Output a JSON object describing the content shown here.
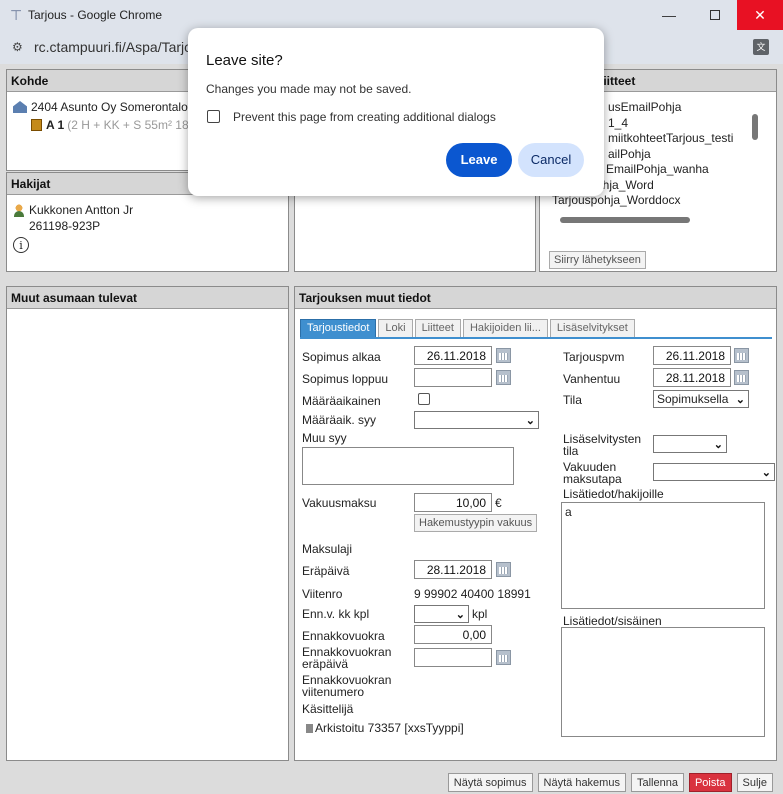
{
  "window": {
    "title": "Tarjous - Google Chrome",
    "minimize": "—",
    "close": "✕"
  },
  "address": {
    "url": "rc.ctampuuri.fi/Aspa/Tarjou"
  },
  "dialog": {
    "title": "Leave site?",
    "message": "Changes you made may not be saved.",
    "checkbox_label": "Prevent this page from creating additional dialogs",
    "leave": "Leave",
    "cancel": "Cancel"
  },
  "kohde": {
    "header": "Kohde",
    "property": "2404 Asunto Oy Somerontalot",
    "apartment": "A 1",
    "apartment_detail": "(2 H + KK + S 55m² 18"
  },
  "hakijat": {
    "header": "Hakijat",
    "name": "Kukkonen Antton Jr",
    "id": "261198-923P",
    "info_glyph": "i"
  },
  "muut": {
    "header": "Muut asumaan tulevat"
  },
  "liitteet": {
    "header": "liitteet",
    "items": [
      "usEmailPohja",
      "1_4",
      "miitkohteetTarjous_testi",
      "ailPohja",
      "EmailPohja_wanha",
      "ohja_Word",
      "Tarjouspohja_Worddocx"
    ],
    "send_button": "Siirry lähetykseen"
  },
  "tarjous": {
    "header": "Tarjouksen muut tiedot",
    "tabs": [
      "Tarjoustiedot",
      "Loki",
      "Liitteet",
      "Hakijoiden lii...",
      "Lisäselvitykset"
    ],
    "labels": {
      "sopimus_alkaa": "Sopimus alkaa",
      "sopimus_loppuu": "Sopimus loppuu",
      "maaraaikainen": "Määräaikainen",
      "maaraaik_syy": "Määräaik. syy",
      "muu_syy": "Muu syy",
      "vakuusmaksu": "Vakuusmaksu",
      "maksulaji": "Maksulaji",
      "erapaiva": "Eräpäivä",
      "viitenro": "Viitenro",
      "ennv_kk": "Enn.v. kk kpl",
      "ennakkovuokra": "Ennakkovuokra",
      "ennakko_erapaiva_1": "Ennakkovuokran",
      "ennakko_erapaiva_2": "eräpäivä",
      "ennakko_viite_1": "Ennakkovuokran",
      "ennakko_viite_2": "viitenumero",
      "kasittelija": "Käsittelijä",
      "tarjouspvm": "Tarjouspvm",
      "vanhentuu": "Vanhentuu",
      "tila": "Tila",
      "lisaselv_tila_1": "Lisäselvitysten",
      "lisaselv_tila_2": "tila",
      "vakuuden_1": "Vakuuden",
      "vakuuden_2": "maksutapa",
      "lisatiedot_hakijoille": "Lisätiedot/hakijoille",
      "lisatiedot_sisainen": "Lisätiedot/sisäinen"
    },
    "values": {
      "sopimus_alkaa": "26.11.2018",
      "vakuusmaksu": "10,00",
      "euro": "€",
      "vakuus_button": "Hakemustyypin vakuus",
      "erapaiva": "28.11.2018",
      "viitenro": "9 99902 40400 18991",
      "kpl": "kpl",
      "ennakkovuokra": "0,00",
      "kasittelija": "Arkistoitu 73357 [xxsTyyppi]",
      "tarjouspvm": "26.11.2018",
      "vanhentuu": "28.11.2018",
      "tila": "Sopimuksella",
      "lisatiedot_hakijoille": "a"
    }
  },
  "buttons": {
    "nayta_sopimus": "Näytä sopimus",
    "nayta_hakemus": "Näytä hakemus",
    "tallenna": "Tallenna",
    "poista": "Poista",
    "sulje": "Sulje"
  }
}
